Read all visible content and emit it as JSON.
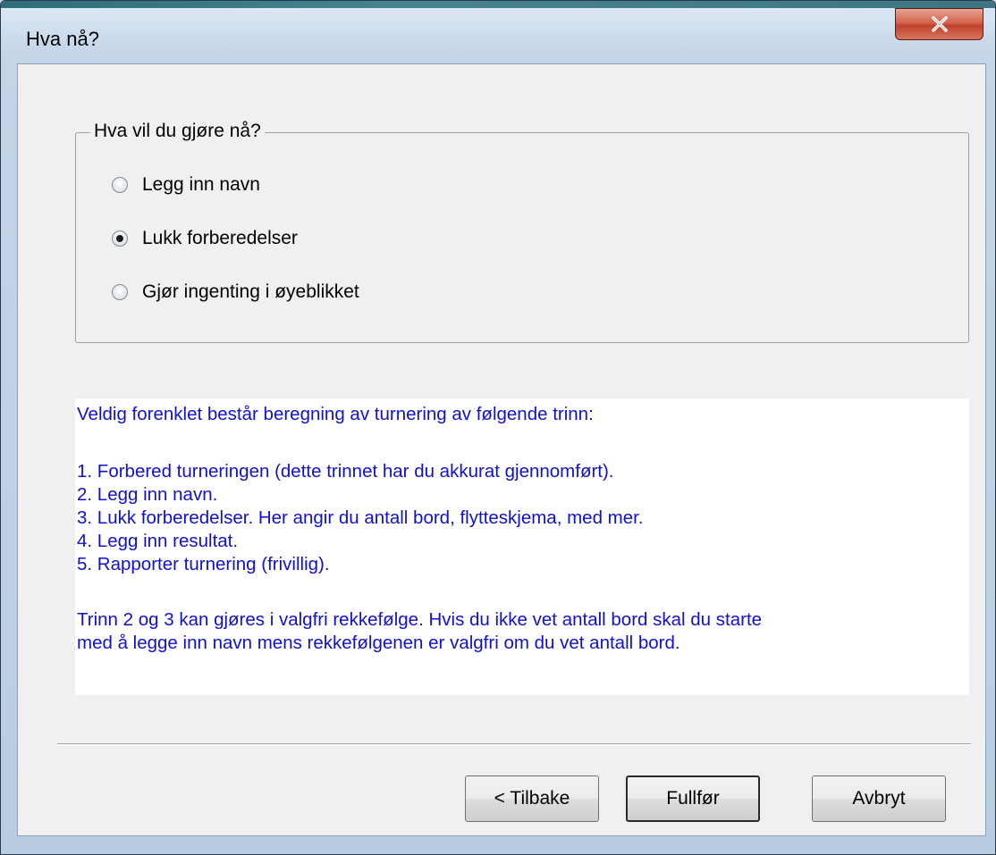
{
  "window": {
    "title": "Hva nå?",
    "close_glyph": "X"
  },
  "choice_group": {
    "legend": "Hva vil du gjøre nå?",
    "options": [
      {
        "label": "Legg inn navn",
        "selected": false
      },
      {
        "label": "Lukk forberedelser",
        "selected": true
      },
      {
        "label": "Gjør ingenting i øyeblikket",
        "selected": false
      }
    ]
  },
  "info": {
    "lines": [
      "Veldig forenklet består beregning av turnering av følgende trinn:",
      "1. Forbered turneringen (dette trinnet har du akkurat gjennomført).",
      "2. Legg inn navn.",
      "3. Lukk forberedelser. Her angir du antall bord, flytteskjema, med mer.",
      "4. Legg inn resultat.",
      "5. Rapporter turnering (frivillig).",
      "Trinn 2 og 3 kan gjøres i valgfri rekkefølge. Hvis du ikke vet antall bord skal du starte",
      "med å legge inn navn mens rekkefølgenen er valgfri om du vet antall bord."
    ],
    "text_color": "#1111cc"
  },
  "buttons": {
    "back": "< Tilbake",
    "finish": "Fullfør",
    "cancel": "Avbryt"
  }
}
